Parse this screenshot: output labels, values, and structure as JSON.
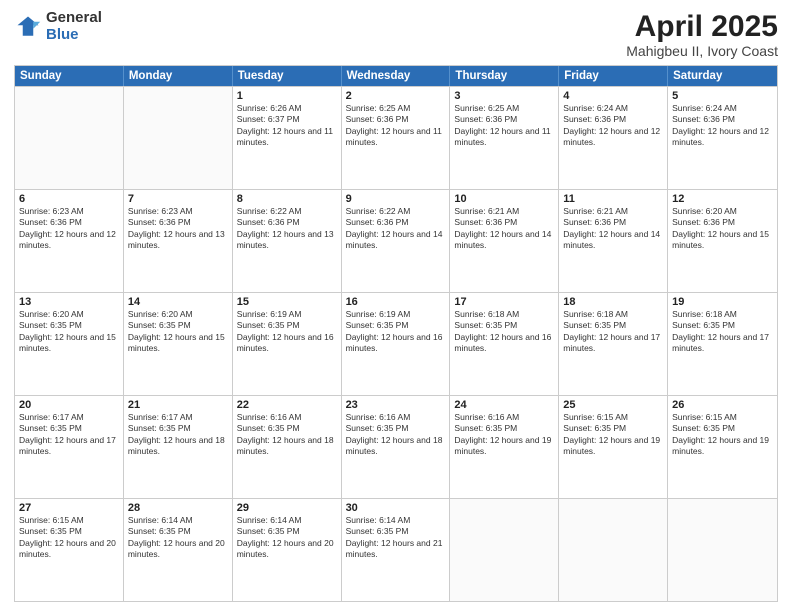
{
  "logo": {
    "general": "General",
    "blue": "Blue"
  },
  "title": {
    "month": "April 2025",
    "location": "Mahigbeu II, Ivory Coast"
  },
  "header": {
    "days": [
      "Sunday",
      "Monday",
      "Tuesday",
      "Wednesday",
      "Thursday",
      "Friday",
      "Saturday"
    ]
  },
  "weeks": [
    [
      {
        "day": "",
        "info": ""
      },
      {
        "day": "",
        "info": ""
      },
      {
        "day": "1",
        "info": "Sunrise: 6:26 AM\nSunset: 6:37 PM\nDaylight: 12 hours and 11 minutes."
      },
      {
        "day": "2",
        "info": "Sunrise: 6:25 AM\nSunset: 6:36 PM\nDaylight: 12 hours and 11 minutes."
      },
      {
        "day": "3",
        "info": "Sunrise: 6:25 AM\nSunset: 6:36 PM\nDaylight: 12 hours and 11 minutes."
      },
      {
        "day": "4",
        "info": "Sunrise: 6:24 AM\nSunset: 6:36 PM\nDaylight: 12 hours and 12 minutes."
      },
      {
        "day": "5",
        "info": "Sunrise: 6:24 AM\nSunset: 6:36 PM\nDaylight: 12 hours and 12 minutes."
      }
    ],
    [
      {
        "day": "6",
        "info": "Sunrise: 6:23 AM\nSunset: 6:36 PM\nDaylight: 12 hours and 12 minutes."
      },
      {
        "day": "7",
        "info": "Sunrise: 6:23 AM\nSunset: 6:36 PM\nDaylight: 12 hours and 13 minutes."
      },
      {
        "day": "8",
        "info": "Sunrise: 6:22 AM\nSunset: 6:36 PM\nDaylight: 12 hours and 13 minutes."
      },
      {
        "day": "9",
        "info": "Sunrise: 6:22 AM\nSunset: 6:36 PM\nDaylight: 12 hours and 14 minutes."
      },
      {
        "day": "10",
        "info": "Sunrise: 6:21 AM\nSunset: 6:36 PM\nDaylight: 12 hours and 14 minutes."
      },
      {
        "day": "11",
        "info": "Sunrise: 6:21 AM\nSunset: 6:36 PM\nDaylight: 12 hours and 14 minutes."
      },
      {
        "day": "12",
        "info": "Sunrise: 6:20 AM\nSunset: 6:36 PM\nDaylight: 12 hours and 15 minutes."
      }
    ],
    [
      {
        "day": "13",
        "info": "Sunrise: 6:20 AM\nSunset: 6:35 PM\nDaylight: 12 hours and 15 minutes."
      },
      {
        "day": "14",
        "info": "Sunrise: 6:20 AM\nSunset: 6:35 PM\nDaylight: 12 hours and 15 minutes."
      },
      {
        "day": "15",
        "info": "Sunrise: 6:19 AM\nSunset: 6:35 PM\nDaylight: 12 hours and 16 minutes."
      },
      {
        "day": "16",
        "info": "Sunrise: 6:19 AM\nSunset: 6:35 PM\nDaylight: 12 hours and 16 minutes."
      },
      {
        "day": "17",
        "info": "Sunrise: 6:18 AM\nSunset: 6:35 PM\nDaylight: 12 hours and 16 minutes."
      },
      {
        "day": "18",
        "info": "Sunrise: 6:18 AM\nSunset: 6:35 PM\nDaylight: 12 hours and 17 minutes."
      },
      {
        "day": "19",
        "info": "Sunrise: 6:18 AM\nSunset: 6:35 PM\nDaylight: 12 hours and 17 minutes."
      }
    ],
    [
      {
        "day": "20",
        "info": "Sunrise: 6:17 AM\nSunset: 6:35 PM\nDaylight: 12 hours and 17 minutes."
      },
      {
        "day": "21",
        "info": "Sunrise: 6:17 AM\nSunset: 6:35 PM\nDaylight: 12 hours and 18 minutes."
      },
      {
        "day": "22",
        "info": "Sunrise: 6:16 AM\nSunset: 6:35 PM\nDaylight: 12 hours and 18 minutes."
      },
      {
        "day": "23",
        "info": "Sunrise: 6:16 AM\nSunset: 6:35 PM\nDaylight: 12 hours and 18 minutes."
      },
      {
        "day": "24",
        "info": "Sunrise: 6:16 AM\nSunset: 6:35 PM\nDaylight: 12 hours and 19 minutes."
      },
      {
        "day": "25",
        "info": "Sunrise: 6:15 AM\nSunset: 6:35 PM\nDaylight: 12 hours and 19 minutes."
      },
      {
        "day": "26",
        "info": "Sunrise: 6:15 AM\nSunset: 6:35 PM\nDaylight: 12 hours and 19 minutes."
      }
    ],
    [
      {
        "day": "27",
        "info": "Sunrise: 6:15 AM\nSunset: 6:35 PM\nDaylight: 12 hours and 20 minutes."
      },
      {
        "day": "28",
        "info": "Sunrise: 6:14 AM\nSunset: 6:35 PM\nDaylight: 12 hours and 20 minutes."
      },
      {
        "day": "29",
        "info": "Sunrise: 6:14 AM\nSunset: 6:35 PM\nDaylight: 12 hours and 20 minutes."
      },
      {
        "day": "30",
        "info": "Sunrise: 6:14 AM\nSunset: 6:35 PM\nDaylight: 12 hours and 21 minutes."
      },
      {
        "day": "",
        "info": ""
      },
      {
        "day": "",
        "info": ""
      },
      {
        "day": "",
        "info": ""
      }
    ]
  ]
}
